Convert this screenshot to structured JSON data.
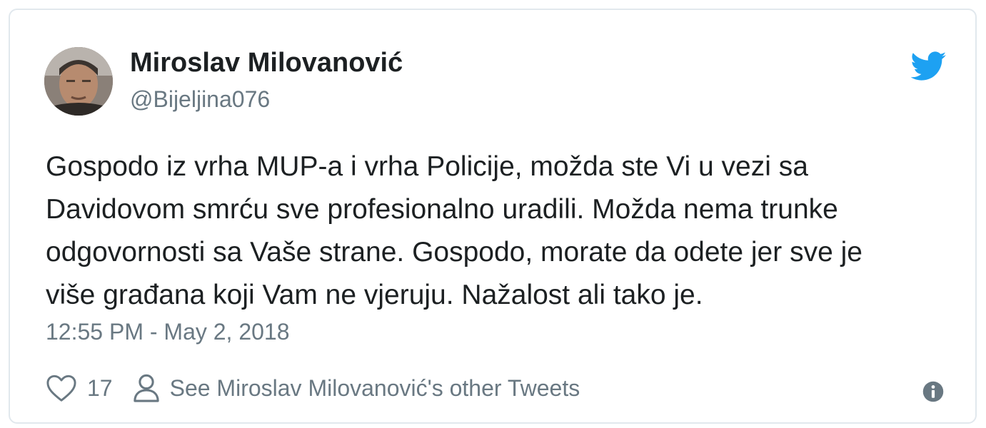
{
  "tweet": {
    "author_name": "Miroslav Milovanović",
    "author_handle": "@Bijeljina076",
    "text": "Gospodo iz vrha MUP-a i vrha Policije, možda ste Vi u vezi sa\nDavidovom smrću sve profesionalno uradili. Možda nema trunke\nodgovornosti sa Vaše strane. Gospodo, morate da odete jer sve je\nviše građana koji Vam ne vjeruju.  Nažalost ali tako je.",
    "timestamp": "12:55 PM - May 2, 2018",
    "like_count": "17",
    "see_other_tweets_label": "See Miroslav Milovanović's other Tweets"
  },
  "icons": {
    "brand": "twitter-bird-icon",
    "like": "heart-icon",
    "profile": "person-icon",
    "info": "info-icon"
  },
  "colors": {
    "brand_blue": "#1da1f2",
    "text": "#1c2022",
    "secondary_text": "#697882",
    "border": "#e1e8ed"
  }
}
